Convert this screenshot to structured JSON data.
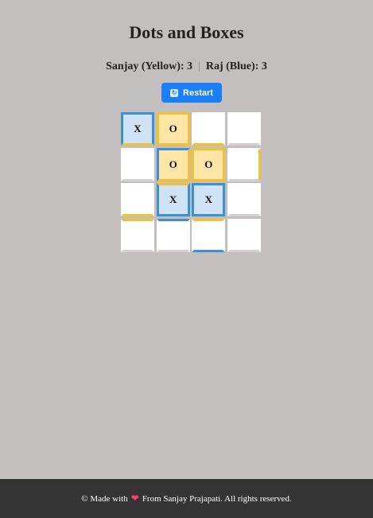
{
  "title": "Dots and Boxes",
  "score": {
    "player1": "Sanjay (Yellow): 3",
    "separator": "|",
    "player2": "Raj (Blue): 3"
  },
  "restart": {
    "label": "Restart",
    "icon": "restart-icon"
  },
  "colors": {
    "yellow": "#f3c130",
    "blue": "#3e91ce",
    "yellow_fill": "#ffe6a6",
    "blue_fill": "#d0e2f5",
    "empty_line": "#c3bfbe",
    "button": "#1a7ef6"
  },
  "board": {
    "rows": 4,
    "cols": 4,
    "cells": [
      [
        {
          "mark": "X",
          "owner": "blue",
          "top": "blue",
          "right": "blue",
          "bottom": "yellow",
          "left": "blue"
        },
        {
          "mark": "O",
          "owner": "yellow",
          "top": "yellow",
          "right": "yellow",
          "bottom": "yellow",
          "left": "yellow"
        },
        {
          "mark": "",
          "owner": "",
          "top": "",
          "right": "",
          "bottom": "yellow",
          "left": ""
        },
        {
          "mark": "",
          "owner": "",
          "top": "",
          "right": "",
          "bottom": "",
          "left": ""
        }
      ],
      [
        {
          "mark": "",
          "owner": "",
          "top": "",
          "right": "",
          "bottom": "",
          "left": ""
        },
        {
          "mark": "O",
          "owner": "yellow",
          "top": "blue",
          "right": "yellow",
          "bottom": "yellow",
          "left": "blue"
        },
        {
          "mark": "O",
          "owner": "yellow",
          "top": "yellow",
          "right": "yellow",
          "bottom": "yellow",
          "left": "yellow"
        },
        {
          "mark": "",
          "owner": "",
          "top": "",
          "right": "yellow",
          "bottom": "",
          "left": ""
        }
      ],
      [
        {
          "mark": "",
          "owner": "",
          "top": "",
          "right": "",
          "bottom": "yellow",
          "left": ""
        },
        {
          "mark": "X",
          "owner": "blue",
          "top": "yellow",
          "right": "blue",
          "bottom": "blue",
          "left": "blue"
        },
        {
          "mark": "X",
          "owner": "blue",
          "top": "blue",
          "right": "blue",
          "bottom": "blue",
          "left": "blue"
        },
        {
          "mark": "",
          "owner": "",
          "top": "",
          "right": "",
          "bottom": "",
          "left": ""
        }
      ],
      [
        {
          "mark": "",
          "owner": "",
          "top": "yellow",
          "right": "",
          "bottom": "",
          "left": ""
        },
        {
          "mark": "",
          "owner": "",
          "top": "blue",
          "right": "",
          "bottom": "",
          "left": ""
        },
        {
          "mark": "",
          "owner": "",
          "top": "yellow",
          "right": "",
          "bottom": "blue",
          "left": ""
        },
        {
          "mark": "",
          "owner": "",
          "top": "",
          "right": "",
          "bottom": "",
          "left": ""
        }
      ]
    ]
  },
  "footer": {
    "prefix": "© Made with",
    "heart_icon": "heart-icon",
    "suffix": "From Sanjay Prajapati. All rights reserved."
  }
}
